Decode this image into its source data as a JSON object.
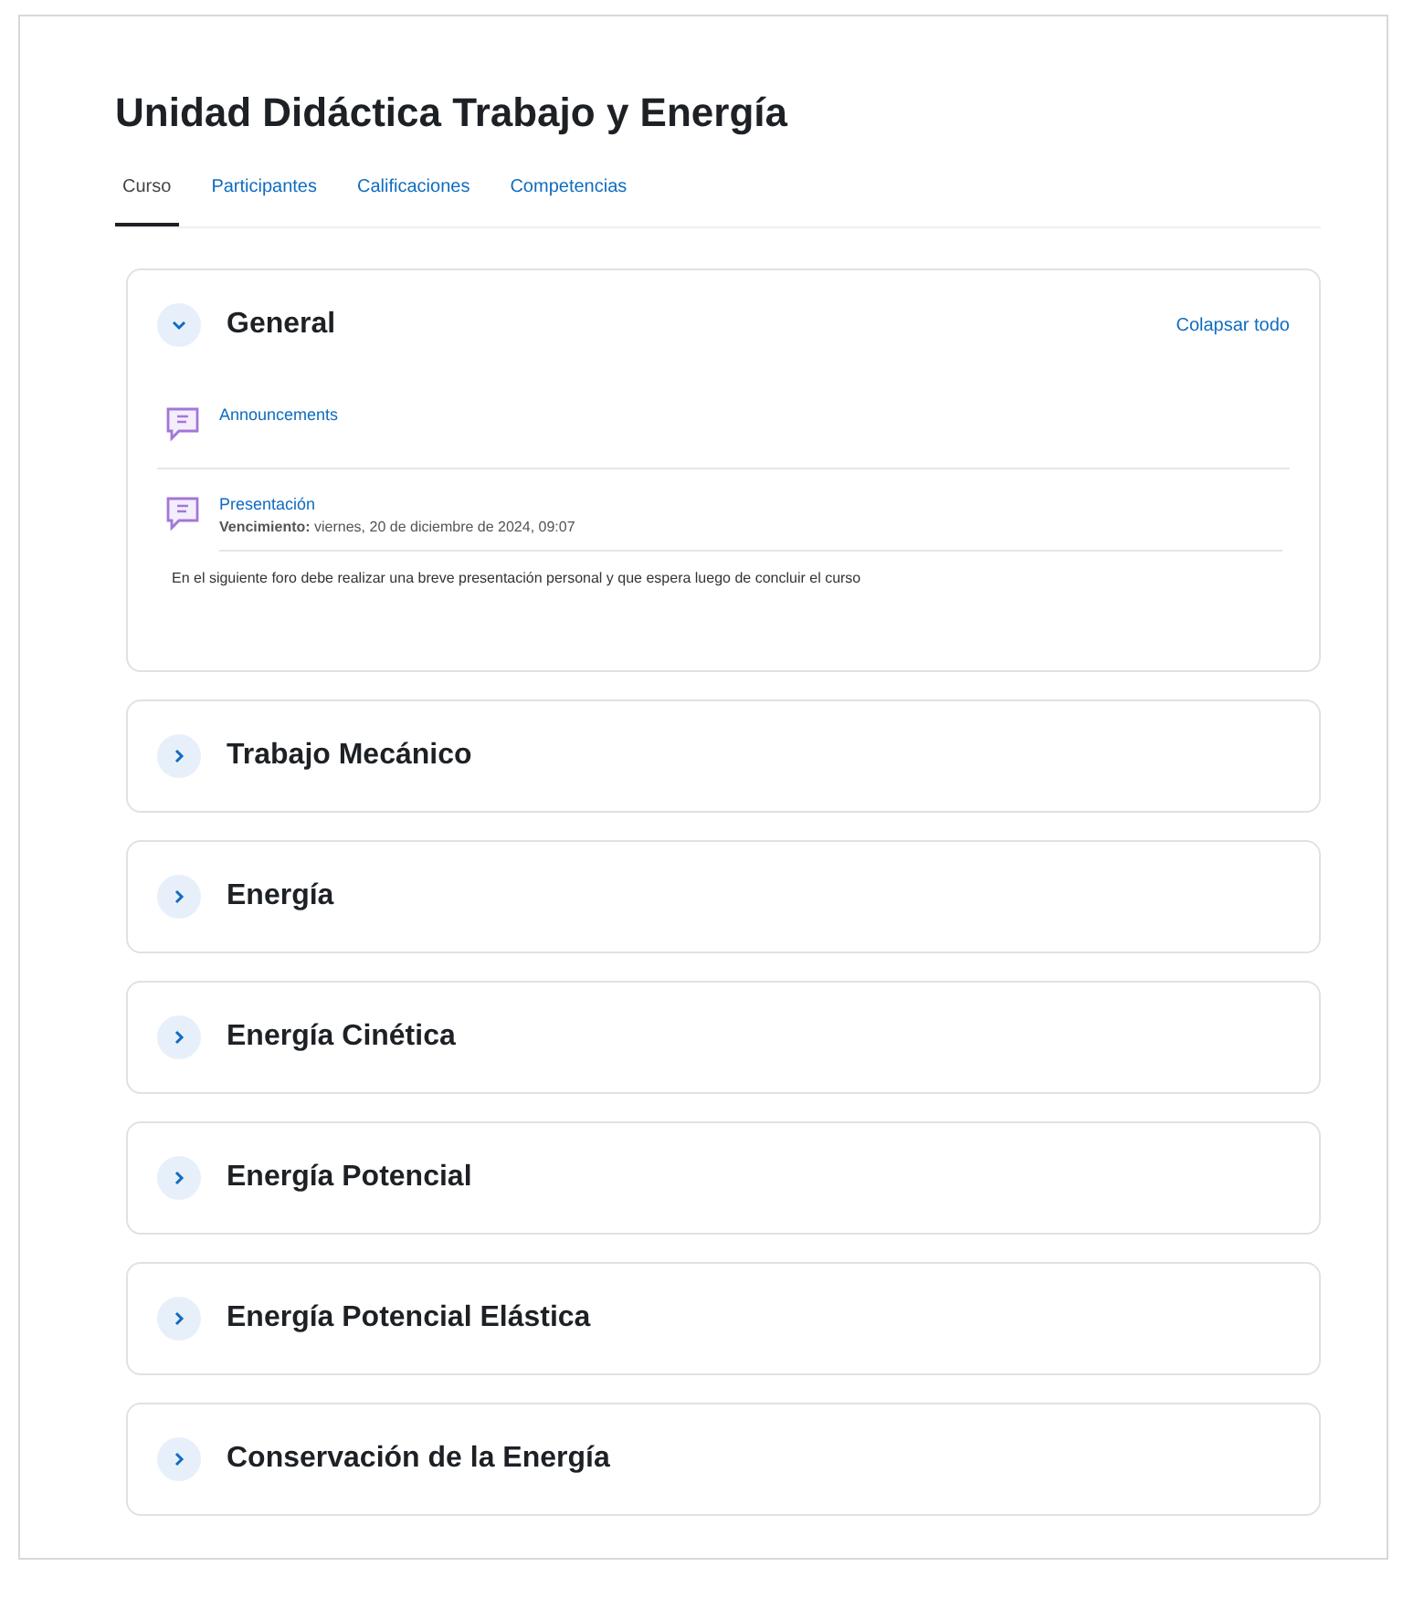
{
  "course": {
    "title": "Unidad Didáctica Trabajo y Energía"
  },
  "tabs": [
    {
      "label": "Curso",
      "selected": true
    },
    {
      "label": "Participantes",
      "selected": false
    },
    {
      "label": "Calificaciones",
      "selected": false
    },
    {
      "label": "Competencias",
      "selected": false
    }
  ],
  "sections": [
    {
      "title": "General",
      "expanded": true,
      "action": "Colapsar todo",
      "activities": [
        {
          "name": "Announcements"
        },
        {
          "name": "Presentación",
          "due_label": "Vencimiento:",
          "due": "viernes, 20 de diciembre de 2024, 09:07",
          "description": "En el siguiente foro debe realizar una breve presentación personal y que espera luego de concluir el curso"
        }
      ]
    },
    {
      "title": "Trabajo Mecánico",
      "expanded": false
    },
    {
      "title": "Energía",
      "expanded": false
    },
    {
      "title": "Energía Cinética",
      "expanded": false
    },
    {
      "title": "Energía Potencial",
      "expanded": false
    },
    {
      "title": "Energía Potencial Elástica",
      "expanded": false
    },
    {
      "title": "Conservación de la Energía",
      "expanded": false
    }
  ]
}
